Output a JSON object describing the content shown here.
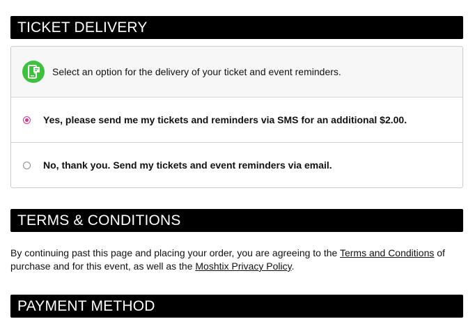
{
  "ticket_delivery": {
    "header": "TICKET DELIVERY",
    "icon": "sms-phone-icon",
    "info_text": "Select an option for the delivery of your ticket and event reminders.",
    "options": [
      {
        "label": "Yes, please send me my tickets and reminders via SMS for an additional $2.00.",
        "selected": true
      },
      {
        "label": "No, thank you. Send my tickets and event reminders via email.",
        "selected": false
      }
    ]
  },
  "terms": {
    "header": "TERMS & CONDITIONS",
    "text_part1": "By continuing past this page and placing your order, you are agreeing to the ",
    "link1": "Terms and Conditions",
    "text_part2": " of purchase and for this event, as well as the ",
    "link2": "Moshtix Privacy Policy",
    "text_part3": "."
  },
  "payment": {
    "header": "PAYMENT METHOD"
  },
  "colors": {
    "header_bg": "#000000",
    "accent_radio": "#d6338a",
    "icon_green": "#3cc23c"
  }
}
